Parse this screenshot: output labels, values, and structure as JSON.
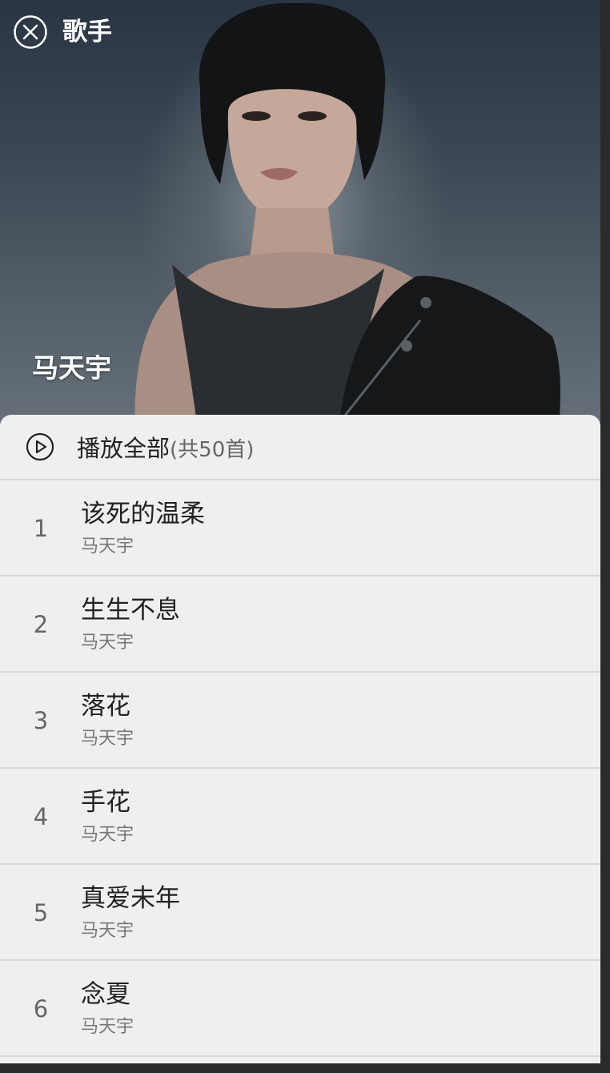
{
  "header": {
    "title": "歌手",
    "close_icon": "close-circle-icon"
  },
  "artist": {
    "name": "马天宇"
  },
  "play_all": {
    "label": "播放全部",
    "count": "(共50首)",
    "icon": "play-circle-icon"
  },
  "songs": [
    {
      "index": "1",
      "title": "该死的温柔",
      "artist": "马天宇"
    },
    {
      "index": "2",
      "title": "生生不息",
      "artist": "马天宇"
    },
    {
      "index": "3",
      "title": "落花",
      "artist": "马天宇"
    },
    {
      "index": "4",
      "title": "手花",
      "artist": "马天宇"
    },
    {
      "index": "5",
      "title": "真爱未年",
      "artist": "马天宇"
    },
    {
      "index": "6",
      "title": "念夏",
      "artist": "马天宇"
    }
  ],
  "colors": {
    "panel_bg": "#eeeff1",
    "divider": "#d9d9db",
    "text_primary": "#222222",
    "text_secondary": "#777777"
  }
}
